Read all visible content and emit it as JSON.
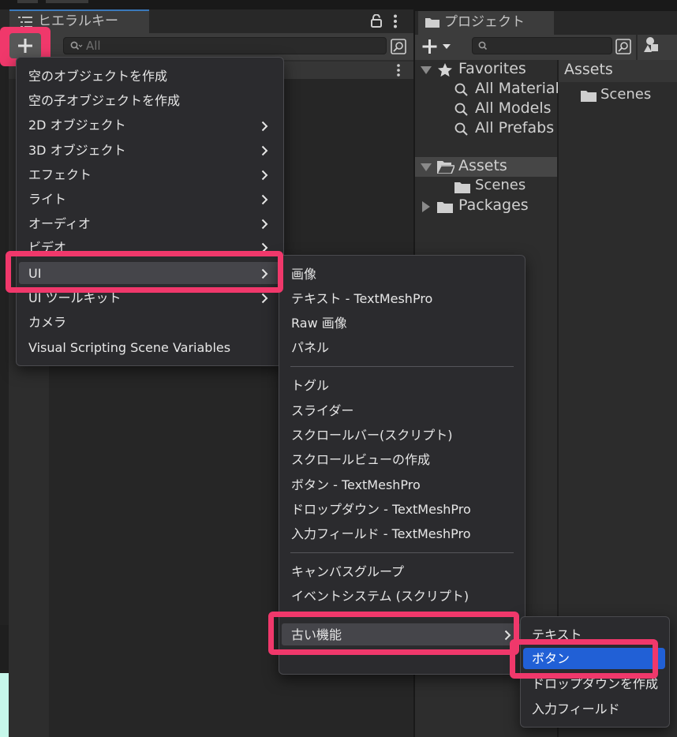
{
  "hierarchy": {
    "tab_title": "ヒエラルキー",
    "search_placeholder": "All"
  },
  "project": {
    "tab_title": "プロジェクト",
    "tree": {
      "favorites": "Favorites",
      "all_material": "All Material",
      "all_models": "All Models",
      "all_prefabs": "All Prefabs",
      "assets": "Assets",
      "scenes": "Scenes",
      "packages": "Packages"
    },
    "assets_pane": {
      "header": "Assets",
      "folder": "Scenes"
    }
  },
  "menu1": {
    "items": [
      "空のオブジェクトを作成",
      "空の子オブジェクトを作成",
      "2D オブジェクト",
      "3D オブジェクト",
      "エフェクト",
      "ライト",
      "オーディオ",
      "ビデオ",
      "UI",
      "UI ツールキット",
      "カメラ",
      "Visual Scripting Scene Variables"
    ]
  },
  "menu2": {
    "items": [
      "画像",
      "テキスト - TextMeshPro",
      "Raw 画像",
      "パネル",
      "トグル",
      "スライダー",
      "スクロールバー(スクリプト)",
      "スクロールビューの作成",
      "ボタン - TextMeshPro",
      "ドロップダウン - TextMeshPro",
      "入力フィールド - TextMeshPro",
      "キャンバスグループ",
      "イベントシステム (スクリプト)",
      "古い機能"
    ]
  },
  "menu3": {
    "items": [
      "テキスト",
      "ボタン",
      "ドロップダウンを作成",
      "入力フィールド"
    ]
  },
  "colors": {
    "highlight_pink": "#f0386b",
    "selected_blue": "#2160d6",
    "menu_bg": "#2b2b2e"
  }
}
